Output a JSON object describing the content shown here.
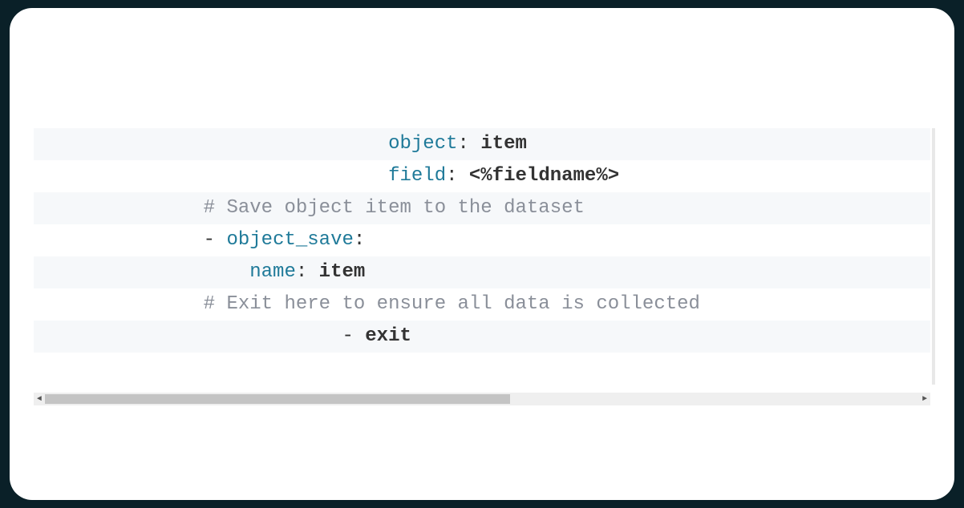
{
  "code": {
    "lines": [
      {
        "indent": "                              ",
        "segments": [
          {
            "cls": "tok-key",
            "text": "object"
          },
          {
            "cls": "tok-plain",
            "text": ": "
          },
          {
            "cls": "tok-value",
            "text": "item"
          }
        ]
      },
      {
        "indent": "                              ",
        "segments": [
          {
            "cls": "tok-key",
            "text": "field"
          },
          {
            "cls": "tok-plain",
            "text": ": "
          },
          {
            "cls": "tok-value",
            "text": "<%fieldname%>"
          }
        ]
      },
      {
        "indent": "              ",
        "segments": [
          {
            "cls": "tok-comment",
            "text": "# Save object item to the dataset"
          }
        ]
      },
      {
        "indent": "              ",
        "segments": [
          {
            "cls": "tok-dash",
            "text": "- "
          },
          {
            "cls": "tok-key",
            "text": "object_save"
          },
          {
            "cls": "tok-plain",
            "text": ":"
          }
        ]
      },
      {
        "indent": "                  ",
        "segments": [
          {
            "cls": "tok-key",
            "text": "name"
          },
          {
            "cls": "tok-plain",
            "text": ": "
          },
          {
            "cls": "tok-value",
            "text": "item"
          }
        ]
      },
      {
        "indent": "              ",
        "segments": [
          {
            "cls": "tok-comment",
            "text": "# Exit here to ensure all data is collected"
          }
        ]
      },
      {
        "indent": "                          ",
        "segments": [
          {
            "cls": "tok-dash",
            "text": "- "
          },
          {
            "cls": "tok-value",
            "text": "exit"
          }
        ]
      }
    ]
  },
  "scrollbar": {
    "left_arrow": "◄",
    "right_arrow": "►"
  }
}
